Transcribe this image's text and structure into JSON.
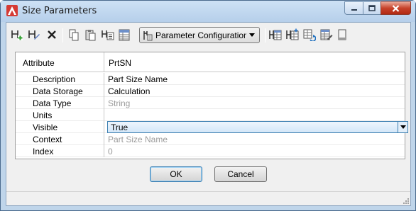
{
  "window": {
    "title": "Size Parameters"
  },
  "toolbar": {
    "icons": [
      "add-parameter-icon",
      "edit-parameter-icon",
      "delete-icon",
      "copy-icon",
      "paste-icon",
      "parameter-list-icon",
      "table-icon",
      "parameter-configuration-icon",
      "size-table-icon",
      "add-table-icon",
      "refresh-icon",
      "edit-table-icon",
      "book-icon"
    ],
    "param_config_label": "Parameter Configuration"
  },
  "grid": {
    "header": {
      "attribute": "Attribute",
      "value": "PrtSN"
    },
    "rows": [
      {
        "label": "Description",
        "value": "Part Size Name",
        "disabled": false
      },
      {
        "label": "Data Storage",
        "value": "Calculation",
        "disabled": false
      },
      {
        "label": "Data Type",
        "value": "String",
        "disabled": true
      },
      {
        "label": "Units",
        "value": "",
        "disabled": false
      },
      {
        "label": "Visible",
        "value": "True",
        "disabled": false
      },
      {
        "label": "Context",
        "value": "Part Size Name",
        "disabled": true
      },
      {
        "label": "Index",
        "value": "0",
        "disabled": true
      }
    ]
  },
  "buttons": {
    "ok": "OK",
    "cancel": "Cancel"
  },
  "colors": {
    "accent": "#3c7fb1",
    "app_icon": "#c8262b"
  }
}
